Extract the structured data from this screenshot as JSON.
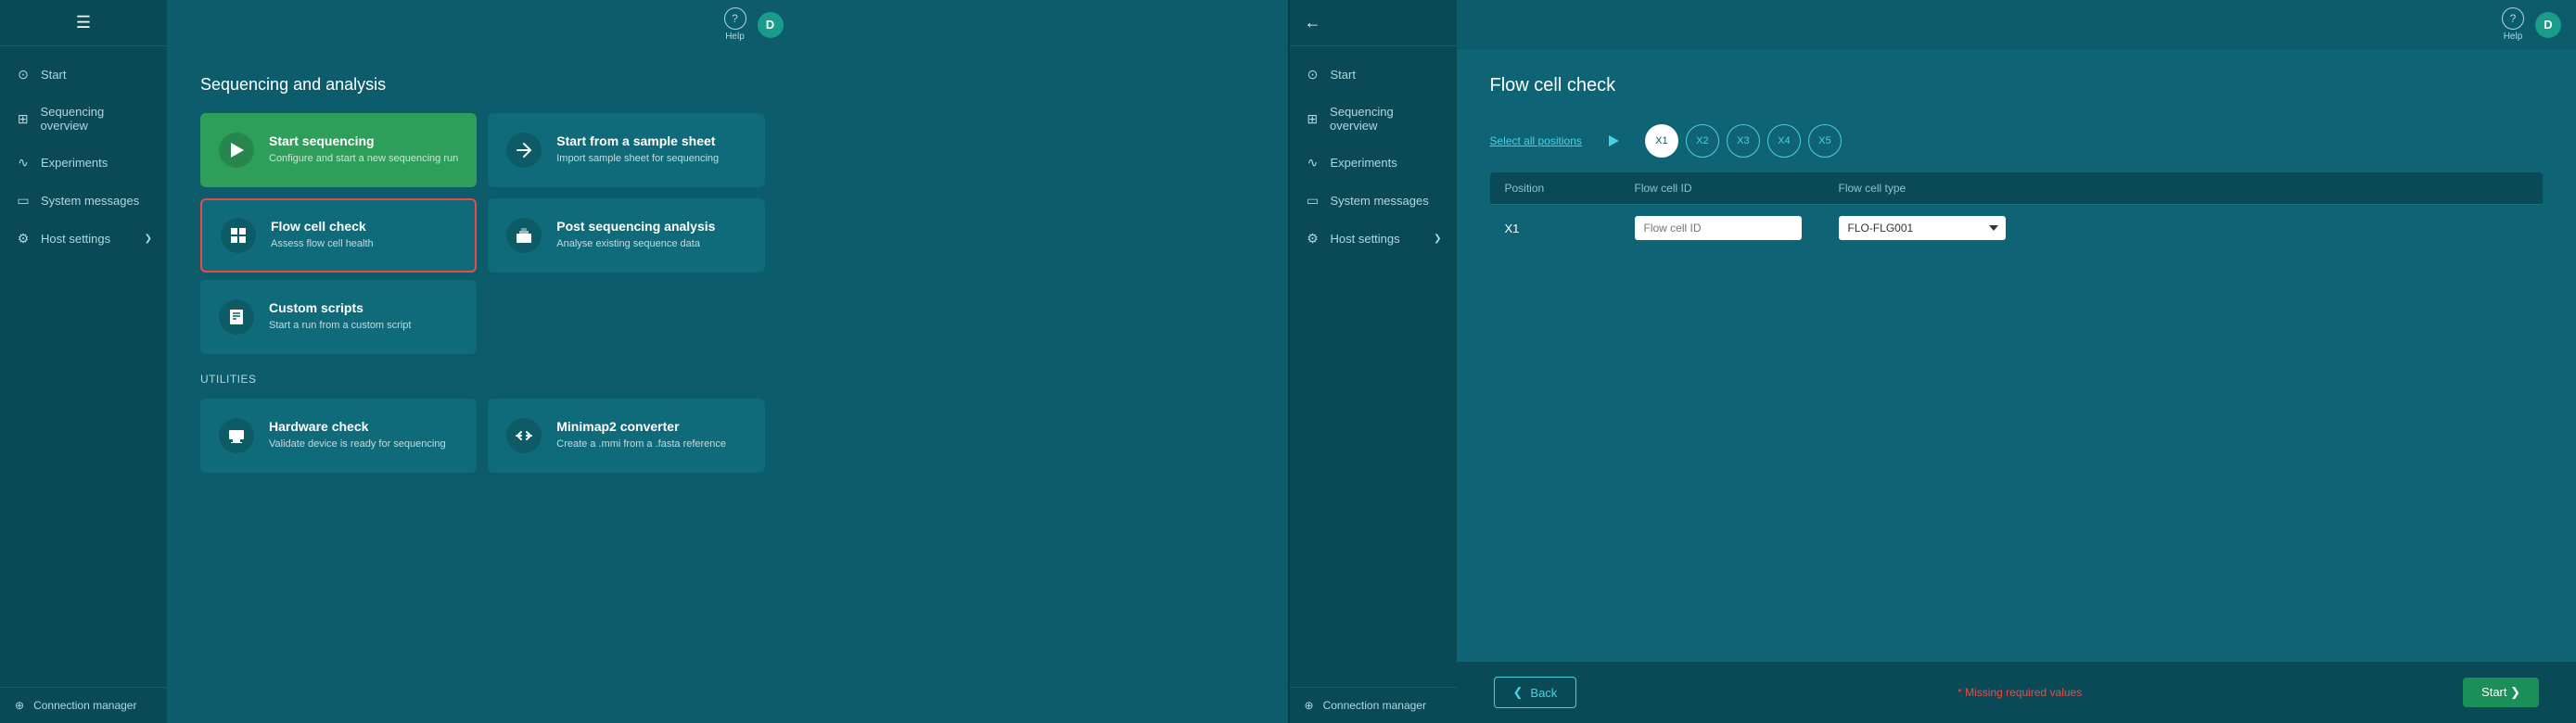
{
  "left": {
    "sidebar": {
      "items": [
        {
          "id": "start",
          "label": "Start",
          "icon": "⊙",
          "active": false
        },
        {
          "id": "sequencing-overview",
          "label": "Sequencing overview",
          "icon": "⊞",
          "active": false
        },
        {
          "id": "experiments",
          "label": "Experiments",
          "icon": "∿",
          "active": false
        },
        {
          "id": "system-messages",
          "label": "System messages",
          "icon": "▭",
          "active": false
        },
        {
          "id": "host-settings",
          "label": "Host settings",
          "icon": "⚙",
          "active": false,
          "hasChevron": true
        }
      ],
      "bottom": {
        "label": "Connection manager",
        "icon": "⊕"
      }
    },
    "topbar": {
      "help": "Help",
      "user": "D"
    },
    "main": {
      "section_title": "Sequencing and analysis",
      "cards": [
        {
          "id": "start-sequencing",
          "title": "Start sequencing",
          "desc": "Configure and start a new sequencing run",
          "icon": "▶",
          "style": "green"
        },
        {
          "id": "start-sample-sheet",
          "title": "Start from a sample sheet",
          "desc": "Import sample sheet for sequencing",
          "icon": "→",
          "style": "teal"
        },
        {
          "id": "flow-cell-check",
          "title": "Flow cell check",
          "desc": "Assess flow cell health",
          "icon": "▦",
          "style": "teal",
          "selected": true
        },
        {
          "id": "post-sequencing",
          "title": "Post sequencing analysis",
          "desc": "Analyse existing sequence data",
          "icon": "▥",
          "style": "teal"
        }
      ],
      "utilities_title": "Utilities",
      "utility_cards": [
        {
          "id": "hardware-check",
          "title": "Hardware check",
          "desc": "Validate device is ready for sequencing",
          "icon": "▨",
          "style": "teal"
        },
        {
          "id": "minimap2",
          "title": "Minimap2 converter",
          "desc": "Create a .mmi from a .fasta reference",
          "icon": "⇄",
          "style": "teal"
        }
      ],
      "custom_card": {
        "id": "custom-scripts",
        "title": "Custom scripts",
        "desc": "Start a run from a custom script",
        "icon": "▤",
        "style": "teal"
      }
    }
  },
  "right": {
    "sidebar": {
      "items": [
        {
          "id": "start",
          "label": "Start",
          "icon": "⊙",
          "active": false
        },
        {
          "id": "sequencing-overview",
          "label": "Sequencing overview",
          "icon": "⊞",
          "active": false
        },
        {
          "id": "experiments",
          "label": "Experiments",
          "icon": "∿",
          "active": false
        },
        {
          "id": "system-messages",
          "label": "System messages",
          "icon": "▭",
          "active": false
        },
        {
          "id": "host-settings",
          "label": "Host settings",
          "icon": "⚙",
          "active": false,
          "hasChevron": true
        }
      ],
      "bottom": {
        "label": "Connection manager",
        "icon": "⊕"
      }
    },
    "topbar": {
      "help": "Help",
      "user": "D"
    },
    "main": {
      "page_title": "Flow cell check",
      "select_all": "Select all positions",
      "positions": [
        "X1",
        "X2",
        "X3",
        "X4",
        "X5"
      ],
      "table": {
        "headers": [
          "Position",
          "Flow cell ID",
          "Flow cell type"
        ],
        "row": {
          "position": "X1",
          "flow_cell_id_placeholder": "Flow cell ID",
          "flow_cell_type": "FLO-FLG001"
        }
      },
      "back_label": "Back",
      "missing_values": "* Missing required values",
      "start_label": "Start ❯"
    }
  }
}
